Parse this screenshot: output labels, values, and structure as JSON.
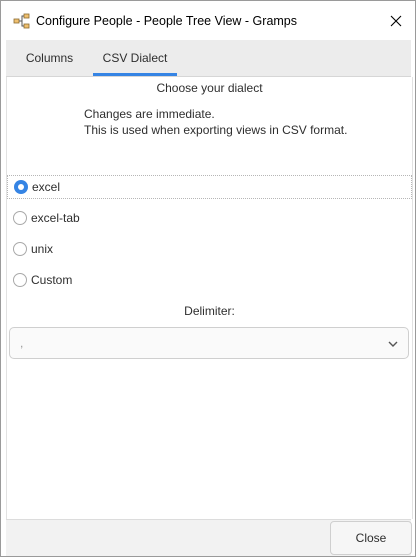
{
  "window": {
    "title": "Configure People - People Tree View - Gramps",
    "app_icon": "gramps-tree-icon",
    "close_icon": "close-icon"
  },
  "tabs": [
    {
      "label": "Columns",
      "active": false
    },
    {
      "label": "CSV Dialect",
      "active": true
    }
  ],
  "panel": {
    "heading": "Choose your dialect",
    "description_line1": "Changes are immediate.",
    "description_line2": "This is used when exporting views in CSV format.",
    "options": [
      {
        "label": "excel",
        "selected": true
      },
      {
        "label": "excel-tab",
        "selected": false
      },
      {
        "label": "unix",
        "selected": false
      },
      {
        "label": "Custom",
        "selected": false
      }
    ],
    "delimiter_label": "Delimiter:",
    "delimiter_value": ","
  },
  "footer": {
    "close_label": "Close"
  },
  "colors": {
    "accent": "#3584e4"
  }
}
